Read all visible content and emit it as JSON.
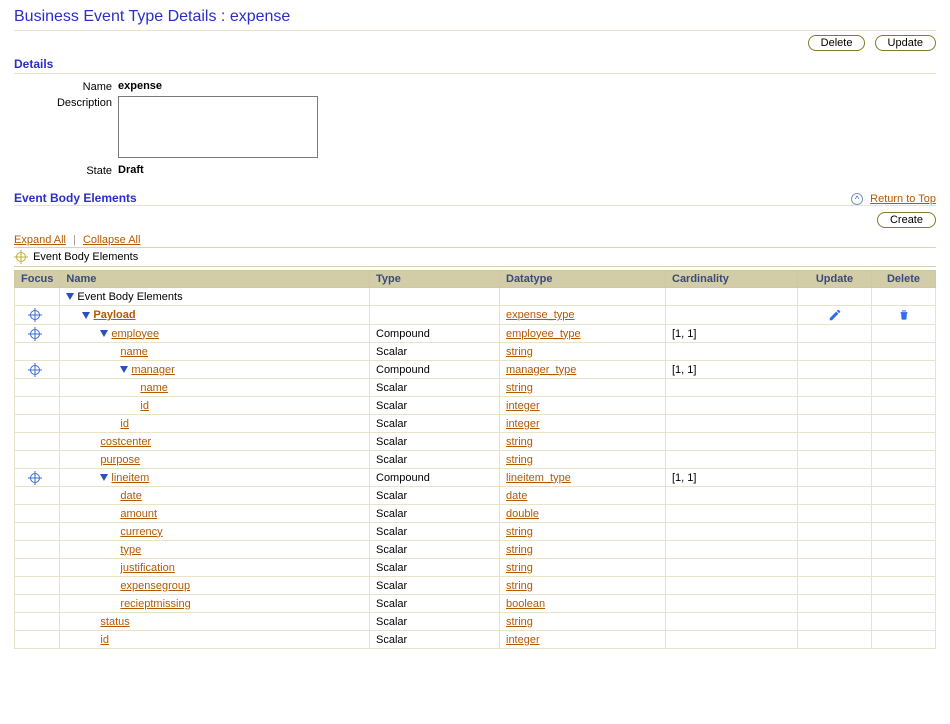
{
  "page": {
    "title": "Business Event Type Details : expense"
  },
  "actions": {
    "delete": "Delete",
    "update": "Update",
    "create": "Create"
  },
  "details": {
    "header": "Details",
    "name_label": "Name",
    "name_value": "expense",
    "description_label": "Description",
    "description_value": "",
    "state_label": "State",
    "state_value": "Draft"
  },
  "body": {
    "header": "Event Body Elements",
    "return_label": "Return to Top",
    "expand_all": "Expand All",
    "collapse_all": "Collapse All",
    "tree_root": "Event Body Elements",
    "columns": {
      "focus": "Focus",
      "name": "Name",
      "type": "Type",
      "datatype": "Datatype",
      "cardinality": "Cardinality",
      "update": "Update",
      "delete": "Delete"
    },
    "rows": [
      {
        "indent": 0,
        "focus": false,
        "tri": true,
        "name": "Event Body Elements",
        "link": false,
        "bold": false,
        "type": "",
        "datatype": "",
        "cardinality": "",
        "update": false,
        "delete": false
      },
      {
        "indent": 1,
        "focus": true,
        "tri": true,
        "name": "Payload",
        "link": true,
        "bold": true,
        "type": "",
        "datatype": "expense_type",
        "cardinality": "",
        "update": true,
        "delete": true
      },
      {
        "indent": 2,
        "focus": true,
        "tri": true,
        "name": "employee",
        "link": true,
        "bold": false,
        "type": "Compound",
        "datatype": "employee_type",
        "cardinality": "[1, 1]",
        "update": false,
        "delete": false
      },
      {
        "indent": 3,
        "focus": false,
        "tri": false,
        "name": "name",
        "link": true,
        "bold": false,
        "type": "Scalar",
        "datatype": "string",
        "cardinality": "",
        "update": false,
        "delete": false
      },
      {
        "indent": 3,
        "focus": true,
        "tri": true,
        "name": "manager",
        "link": true,
        "bold": false,
        "type": "Compound",
        "datatype": "manager_type",
        "cardinality": "[1, 1]",
        "update": false,
        "delete": false
      },
      {
        "indent": 4,
        "focus": false,
        "tri": false,
        "name": "name",
        "link": true,
        "bold": false,
        "type": "Scalar",
        "datatype": "string",
        "cardinality": "",
        "update": false,
        "delete": false
      },
      {
        "indent": 4,
        "focus": false,
        "tri": false,
        "name": "id",
        "link": true,
        "bold": false,
        "type": "Scalar",
        "datatype": "integer",
        "cardinality": "",
        "update": false,
        "delete": false
      },
      {
        "indent": 3,
        "focus": false,
        "tri": false,
        "name": "id",
        "link": true,
        "bold": false,
        "type": "Scalar",
        "datatype": "integer",
        "cardinality": "",
        "update": false,
        "delete": false
      },
      {
        "indent": 2,
        "focus": false,
        "tri": false,
        "name": "costcenter",
        "link": true,
        "bold": false,
        "type": "Scalar",
        "datatype": "string",
        "cardinality": "",
        "update": false,
        "delete": false
      },
      {
        "indent": 2,
        "focus": false,
        "tri": false,
        "name": "purpose",
        "link": true,
        "bold": false,
        "type": "Scalar",
        "datatype": "string",
        "cardinality": "",
        "update": false,
        "delete": false
      },
      {
        "indent": 2,
        "focus": true,
        "tri": true,
        "name": "lineitem",
        "link": true,
        "bold": false,
        "type": "Compound",
        "datatype": "lineitem_type",
        "cardinality": "[1, 1]",
        "update": false,
        "delete": false
      },
      {
        "indent": 3,
        "focus": false,
        "tri": false,
        "name": "date",
        "link": true,
        "bold": false,
        "type": "Scalar",
        "datatype": "date",
        "cardinality": "",
        "update": false,
        "delete": false
      },
      {
        "indent": 3,
        "focus": false,
        "tri": false,
        "name": "amount",
        "link": true,
        "bold": false,
        "type": "Scalar",
        "datatype": "double",
        "cardinality": "",
        "update": false,
        "delete": false
      },
      {
        "indent": 3,
        "focus": false,
        "tri": false,
        "name": "currency",
        "link": true,
        "bold": false,
        "type": "Scalar",
        "datatype": "string",
        "cardinality": "",
        "update": false,
        "delete": false
      },
      {
        "indent": 3,
        "focus": false,
        "tri": false,
        "name": "type",
        "link": true,
        "bold": false,
        "type": "Scalar",
        "datatype": "string",
        "cardinality": "",
        "update": false,
        "delete": false
      },
      {
        "indent": 3,
        "focus": false,
        "tri": false,
        "name": "justification",
        "link": true,
        "bold": false,
        "type": "Scalar",
        "datatype": "string",
        "cardinality": "",
        "update": false,
        "delete": false
      },
      {
        "indent": 3,
        "focus": false,
        "tri": false,
        "name": "expensegroup",
        "link": true,
        "bold": false,
        "type": "Scalar",
        "datatype": "string",
        "cardinality": "",
        "update": false,
        "delete": false
      },
      {
        "indent": 3,
        "focus": false,
        "tri": false,
        "name": "recieptmissing",
        "link": true,
        "bold": false,
        "type": "Scalar",
        "datatype": "boolean",
        "cardinality": "",
        "update": false,
        "delete": false
      },
      {
        "indent": 2,
        "focus": false,
        "tri": false,
        "name": "status",
        "link": true,
        "bold": false,
        "type": "Scalar",
        "datatype": "string",
        "cardinality": "",
        "update": false,
        "delete": false
      },
      {
        "indent": 2,
        "focus": false,
        "tri": false,
        "name": "id",
        "link": true,
        "bold": false,
        "type": "Scalar",
        "datatype": "integer",
        "cardinality": "",
        "update": false,
        "delete": false
      }
    ]
  }
}
